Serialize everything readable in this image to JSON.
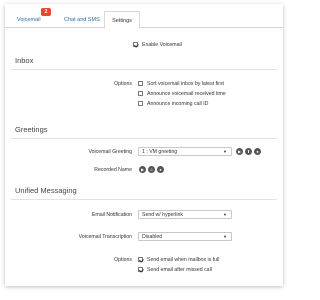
{
  "tabs": [
    {
      "label": "Voicemail",
      "badge": "2"
    },
    {
      "label": "Chat and SMS"
    },
    {
      "label": "Settings"
    }
  ],
  "enable_voicemail": {
    "label": "Enable Voicemail",
    "checked": true
  },
  "inbox": {
    "title": "Inbox",
    "options_label": "Options",
    "options": [
      {
        "label": "Sort voicemail inbox by latest first",
        "checked": false
      },
      {
        "label": "Announce voicemail received time",
        "checked": false
      },
      {
        "label": "Announce incoming call ID",
        "checked": false
      }
    ]
  },
  "greetings": {
    "title": "Greetings",
    "voicemail_greeting_label": "Voicemail Greeting",
    "voicemail_greeting_value": "1 : VM greeting",
    "recorded_name_label": "Recorded Name"
  },
  "unified": {
    "title": "Unified Messaging",
    "email_notification_label": "Email Notification",
    "email_notification_value": "Send w/ hyperlink",
    "voicemail_transcription_label": "Voicemail Transcription",
    "voicemail_transcription_value": "Disabled",
    "options_label": "Options",
    "options": [
      {
        "label": "Send email when mailbox is full",
        "checked": true
      },
      {
        "label": "Send email after missed call",
        "checked": true
      }
    ]
  },
  "icons": {
    "play": "play-icon",
    "record": "record-icon",
    "upload": "upload-icon",
    "user": "user-icon"
  }
}
